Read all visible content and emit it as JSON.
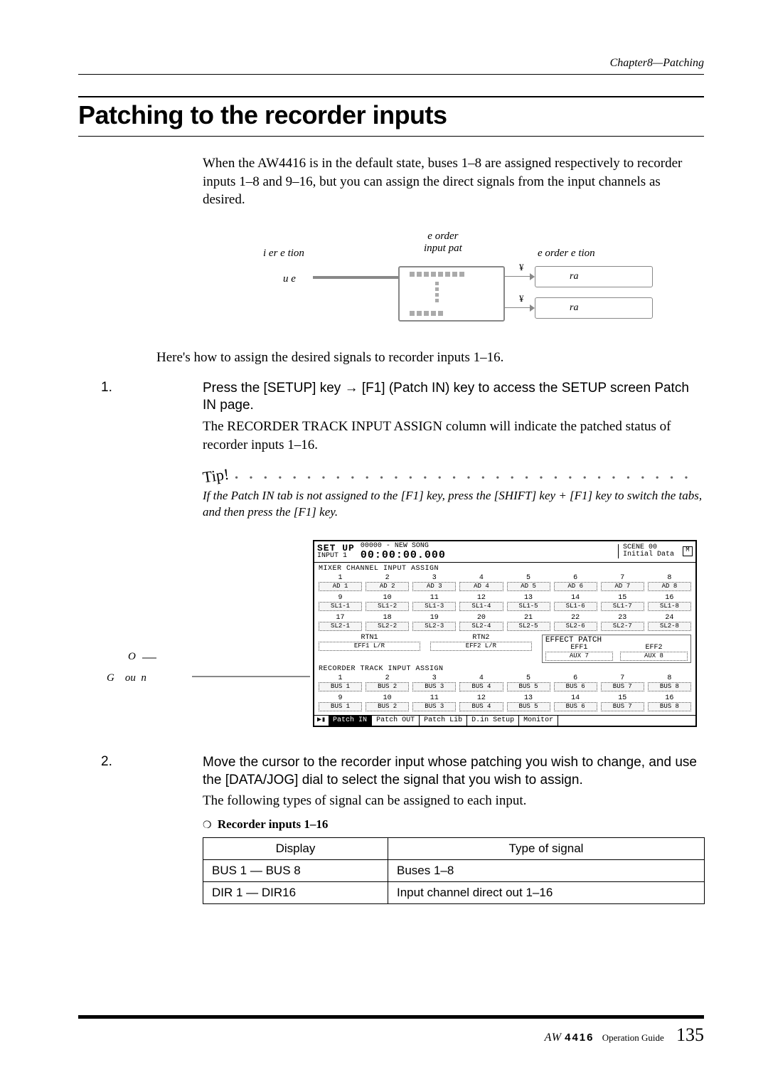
{
  "header": {
    "chapter": "Chapter8—Patching"
  },
  "title": "Patching to the recorder inputs",
  "intro": "When the AW4416 is in the default state, buses 1–8 are assigned respectively to recorder inputs 1–8 and 9–16, but you can assign the direct signals from the input channels as desired.",
  "diagram": {
    "left_top": "i er e tion",
    "center_top": "e order\ninput pat",
    "right_top": "e order e tion",
    "left_mid": "u e",
    "track_box1": "ra",
    "track_box2": "ra",
    "yen": "¥"
  },
  "lead": "Here's how to assign the desired signals to recorder inputs 1–16.",
  "step1": {
    "num": "1.",
    "title": "Press the [SETUP] key → [F1] (Patch IN) key to access the SETUP screen Patch IN page.",
    "body": "The RECORDER TRACK INPUT ASSIGN column will indicate the patched status of recorder inputs 1–16."
  },
  "tip": {
    "label": "Tip!",
    "text": "If the Patch IN tab is not assigned to the [F1] key, press the [SHIFT] key + [F1] key to switch the tabs, and then press the [F1] key."
  },
  "side_labels": {
    "l1": "O",
    "l2": "G    ou  n"
  },
  "screenshot": {
    "title": "SET UP",
    "sub": "INPUT 1",
    "song": "00000 - NEW SONG",
    "time": "00:00:00.000",
    "scene_lbl": "SCENE 00",
    "scene_val": "Initial Data",
    "sec1_title": "MIXER CHANNEL INPUT ASSIGN",
    "row1": {
      "nums": [
        "1",
        "2",
        "3",
        "4",
        "5",
        "6",
        "7",
        "8"
      ],
      "vals": [
        "AD  1",
        "AD  2",
        "AD  3",
        "AD  4",
        "AD  5",
        "AD  6",
        "AD  7",
        "AD  8"
      ]
    },
    "row2": {
      "nums": [
        "9",
        "10",
        "11",
        "12",
        "13",
        "14",
        "15",
        "16"
      ],
      "vals": [
        "SL1-1",
        "SL1-2",
        "SL1-3",
        "SL1-4",
        "SL1-5",
        "SL1-6",
        "SL1-7",
        "SL1-8"
      ]
    },
    "row3": {
      "nums": [
        "17",
        "18",
        "19",
        "20",
        "21",
        "22",
        "23",
        "24"
      ],
      "vals": [
        "SL2-1",
        "SL2-2",
        "SL2-3",
        "SL2-4",
        "SL2-5",
        "SL2-6",
        "SL2-7",
        "SL2-8"
      ]
    },
    "rtn1_lbl": "RTN1",
    "rtn1_val": "EFF1 L/R",
    "rtn2_lbl": "RTN2",
    "rtn2_val": "EFF2 L/R",
    "effpatch_title": "EFFECT PATCH",
    "eff1_lbl": "EFF1",
    "eff1_val": "AUX    7",
    "eff2_lbl": "EFF2",
    "eff2_val": "AUX    8",
    "sec2_title": "RECORDER TRACK INPUT ASSIGN",
    "rrow1": {
      "nums": [
        "1",
        "2",
        "3",
        "4",
        "5",
        "6",
        "7",
        "8"
      ],
      "vals": [
        "BUS 1",
        "BUS 2",
        "BUS 3",
        "BUS 4",
        "BUS 5",
        "BUS 6",
        "BUS 7",
        "BUS 8"
      ]
    },
    "rrow2": {
      "nums": [
        "9",
        "10",
        "11",
        "12",
        "13",
        "14",
        "15",
        "16"
      ],
      "vals": [
        "BUS 1",
        "BUS 2",
        "BUS 3",
        "BUS 4",
        "BUS 5",
        "BUS 6",
        "BUS 7",
        "BUS 8"
      ]
    },
    "tabs": [
      "Patch IN",
      "Patch OUT",
      "Patch Lib",
      "D.in Setup",
      "Monitor"
    ]
  },
  "step2": {
    "num": "2.",
    "title": "Move the cursor to the recorder input whose patching you wish to change, and use the [DATA/JOG] dial to select the signal that you wish to assign.",
    "body": "The following types of signal can be assigned to each input."
  },
  "table": {
    "heading": "Recorder inputs 1–16",
    "col1": "Display",
    "col2": "Type of signal",
    "r1c1": "BUS 1 — BUS 8",
    "r1c2": "Buses 1–8",
    "r2c1": "DIR 1 — DIR16",
    "r2c2": "Input channel direct out 1–16"
  },
  "footer": {
    "logo": "AW",
    "model": "4416",
    "guide": "Operation Guide",
    "page": "135"
  }
}
